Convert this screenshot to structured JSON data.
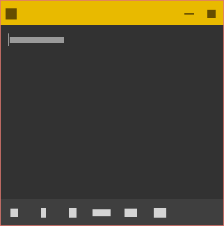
{
  "window": {
    "title": "",
    "colors": {
      "titlebar": "#e8ba00",
      "titlebar_icons": "#654d00",
      "content_bg": "#323232",
      "bottombar_bg": "#3f3f3f",
      "border": "#e07870"
    },
    "controls": {
      "app_icon": "app-icon",
      "minimize_icon": "minimize-icon",
      "maximize_icon": "maximize-icon"
    }
  },
  "editor": {
    "input_value": "",
    "placeholder": ""
  },
  "toolbar": {
    "tools": [
      {
        "icon": "tool-icon-1",
        "label": ""
      },
      {
        "icon": "tool-icon-2",
        "label": ""
      },
      {
        "icon": "tool-icon-3",
        "label": ""
      },
      {
        "icon": "tool-icon-4",
        "label": ""
      },
      {
        "icon": "tool-icon-5",
        "label": ""
      },
      {
        "icon": "tool-icon-6",
        "label": ""
      }
    ]
  }
}
